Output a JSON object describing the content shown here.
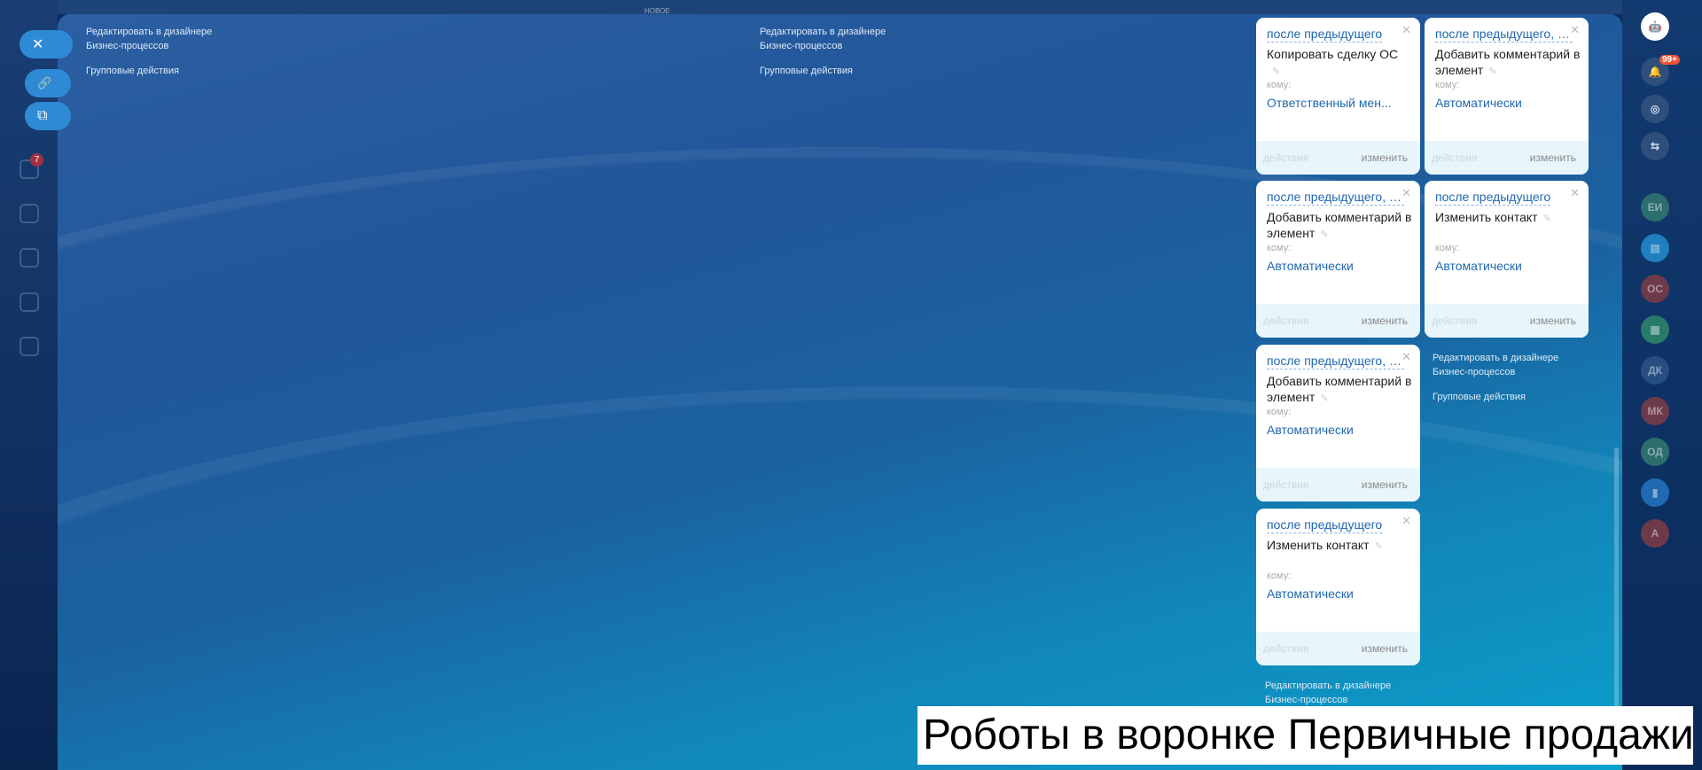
{
  "topbar": {
    "new_label": "НОВОЕ"
  },
  "leftbar": {
    "tasks_badge": "7"
  },
  "slider_buttons": [
    {
      "icon": "close-icon",
      "glyph": "✕"
    },
    {
      "icon": "link-icon",
      "glyph": "🔗"
    },
    {
      "icon": "open-window-icon",
      "glyph": "⧉"
    }
  ],
  "columns": [
    {
      "edit_link": "Редактировать в дизайнере",
      "edit_link2": "Бизнес-процессов",
      "group_actions": "Групповые действия"
    },
    {
      "edit_link": "Редактировать в дизайнере",
      "edit_link2": "Бизнес-процессов",
      "group_actions": "Групповые действия"
    },
    {
      "edit_link": "Редактировать в дизайнере",
      "edit_link2": "Бизнес-процессов",
      "group_actions": "Групповые действия"
    },
    {
      "edit_link": "Редактировать в дизайнере",
      "edit_link2": "Бизнес-процессов"
    }
  ],
  "robots": [
    {
      "trigger": "после предыдущего",
      "title": "Копировать сделку ОС",
      "to_label": "кому:",
      "to": "Ответственный мен...",
      "actions": "действия",
      "edit": "изменить"
    },
    {
      "trigger": "после предыдущего, п...",
      "title": "Добавить комментарий в элемент",
      "to_label": "кому:",
      "to": "Автоматически",
      "actions": "действия",
      "edit": "изменить"
    },
    {
      "trigger": "после предыдущего, п...",
      "title": "Добавить комментарий в элемент",
      "to_label": "кому:",
      "to": "Автоматически",
      "actions": "действия",
      "edit": "изменить"
    },
    {
      "trigger": "после предыдущего",
      "title": "Изменить контакт",
      "to_label": "кому:",
      "to": "Автоматически",
      "actions": "действия",
      "edit": "изменить"
    },
    {
      "trigger": "после предыдущего, п...",
      "title": "Добавить комментарий в элемент",
      "to_label": "кому:",
      "to": "Автоматически",
      "actions": "действия",
      "edit": "изменить"
    },
    {
      "trigger": "после предыдущего",
      "title": "Изменить контакт",
      "to_label": "кому:",
      "to": "Автоматически",
      "actions": "действия",
      "edit": "изменить"
    }
  ],
  "rightbar": {
    "notifications_badge": "99+",
    "avatars": [
      "ЕИ",
      "ОС",
      "ДК",
      "МК",
      "ОД",
      "А"
    ]
  },
  "caption": "Роботы в воронке Первичные продажи"
}
